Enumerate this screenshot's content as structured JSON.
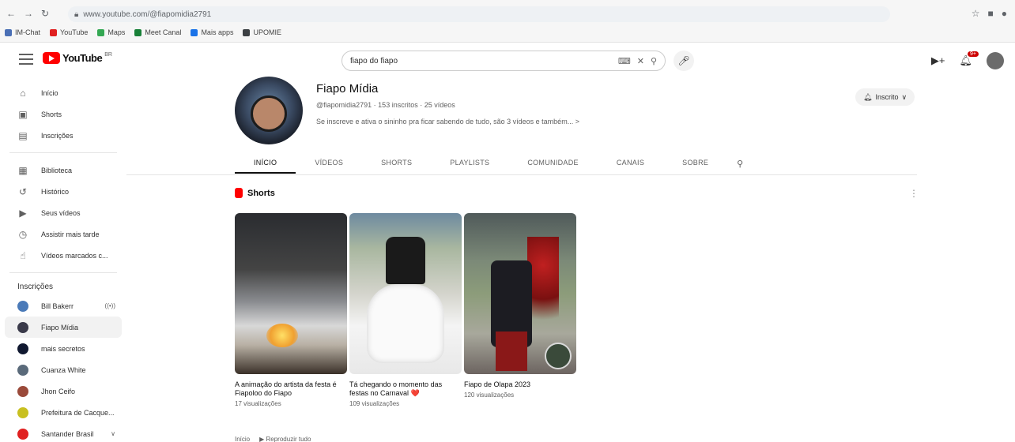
{
  "browser": {
    "url": "www.youtube.com/@fiapomidia2791",
    "nav": [
      "←",
      "→",
      "↻"
    ],
    "bookmarks": [
      {
        "label": "IM-Chat",
        "color": "#4a6fb5"
      },
      {
        "label": "YouTube",
        "color": "#e02020"
      },
      {
        "label": "Maps",
        "color": "#34a853"
      },
      {
        "label": "Meet Canal",
        "color": "#188038"
      },
      {
        "label": "Mais apps",
        "color": "#1a73e8"
      },
      {
        "label": "UPOMIE",
        "color": "#3c4043"
      }
    ]
  },
  "header": {
    "logo_text": "YouTube",
    "logo_sup": "BR",
    "search_value": "fiapo do fiapo",
    "search_icon": "search-icon",
    "mic_icon": "mic-icon",
    "notif_count": "9+"
  },
  "sidebar": {
    "main": [
      {
        "icon": "home-icon",
        "glyph": "⌂",
        "label": "Início"
      },
      {
        "icon": "shorts-icon",
        "glyph": "▣",
        "label": "Shorts"
      },
      {
        "icon": "subscriptions-icon",
        "glyph": "▤",
        "label": "Inscrições"
      }
    ],
    "library": [
      {
        "icon": "library-icon",
        "glyph": "▦",
        "label": "Biblioteca"
      },
      {
        "icon": "history-icon",
        "glyph": "↺",
        "label": "Histórico"
      },
      {
        "icon": "your-videos-icon",
        "glyph": "▶",
        "label": "Seus vídeos"
      },
      {
        "icon": "watch-later-icon",
        "glyph": "◷",
        "label": "Assistir mais tarde"
      },
      {
        "icon": "liked-icon",
        "glyph": "☝",
        "label": "Vídeos marcados c..."
      }
    ],
    "subs_title": "Inscrições",
    "subs": [
      {
        "label": "Bill Bakerr",
        "color": "#4a7ab8",
        "badge": "((•))",
        "active": false
      },
      {
        "label": "Fiapo Mídia",
        "color": "#3a3a4a",
        "badge": "",
        "active": true
      },
      {
        "label": "mais secretos",
        "color": "#101830",
        "badge": "",
        "active": false
      },
      {
        "label": "Cuanza White",
        "color": "#5a6a7a",
        "badge": "",
        "active": false
      },
      {
        "label": "Jhon Ceifo",
        "color": "#9a4a3a",
        "badge": "",
        "active": false
      },
      {
        "label": "Prefeitura de Cacque...",
        "color": "#c8c020",
        "badge": "",
        "active": false
      },
      {
        "label": "Santander Brasil",
        "color": "#e02020",
        "badge": "∨",
        "active": false
      }
    ]
  },
  "channel": {
    "name": "Fiapo Mídia",
    "meta": "@fiapomidia2791 · 153 inscritos · 25 vídeos",
    "description": "Se inscreve e ativa o sininho pra ficar sabendo de tudo, são 3 vídeos e também...",
    "desc_arrow": ">",
    "subscribe_label": "Inscrito",
    "bell_icon": "bell-icon"
  },
  "tabs": [
    "INÍCIO",
    "VÍDEOS",
    "SHORTS",
    "PLAYLISTS",
    "COMUNIDADE",
    "CANAIS",
    "SOBRE"
  ],
  "tabs_active": 0,
  "shorts_section": {
    "title": "Shorts",
    "more": "⋮",
    "items": [
      {
        "title": "A animação do artista da festa é Fiapoloo do Fiapo",
        "views": "17 visualizações"
      },
      {
        "title": "Tá chegando o momento das festas no Carnaval ❤️",
        "views": "109 visualizações"
      },
      {
        "title": "Fiapo de Olapa 2023",
        "views": "120 visualizações"
      }
    ]
  },
  "bottom": {
    "label": "Início",
    "play_all": "▶ Reproduzir tudo"
  }
}
